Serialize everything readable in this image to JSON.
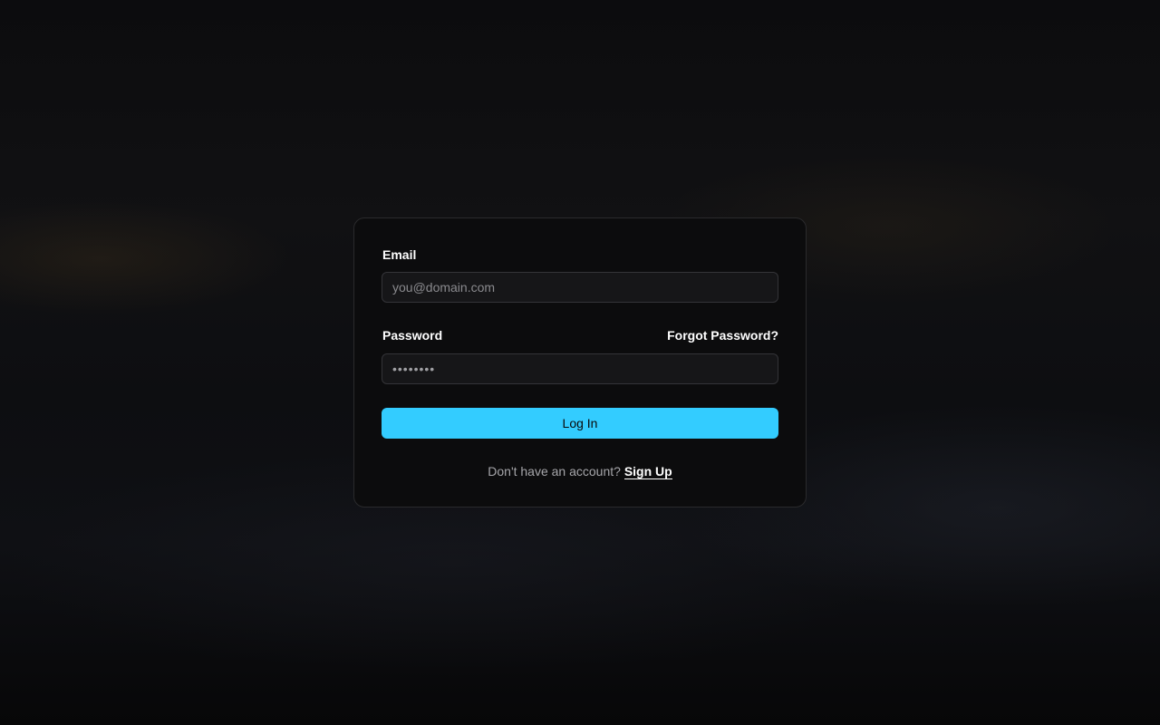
{
  "colors": {
    "accent": "#33ccff",
    "card_background": "#0c0c0d",
    "card_border": "#2a2a2c",
    "field_background": "#161618",
    "text_primary": "#ffffff",
    "text_muted": "#a6a6aa"
  },
  "login_form": {
    "email": {
      "label": "Email",
      "placeholder": "you@domain.com",
      "value": ""
    },
    "password": {
      "label": "Password",
      "value": "••••••••",
      "forgot_label": "Forgot Password?"
    },
    "submit_label": "Log In",
    "signup": {
      "prompt": "Don't have an account?",
      "link_label": "Sign Up"
    }
  }
}
